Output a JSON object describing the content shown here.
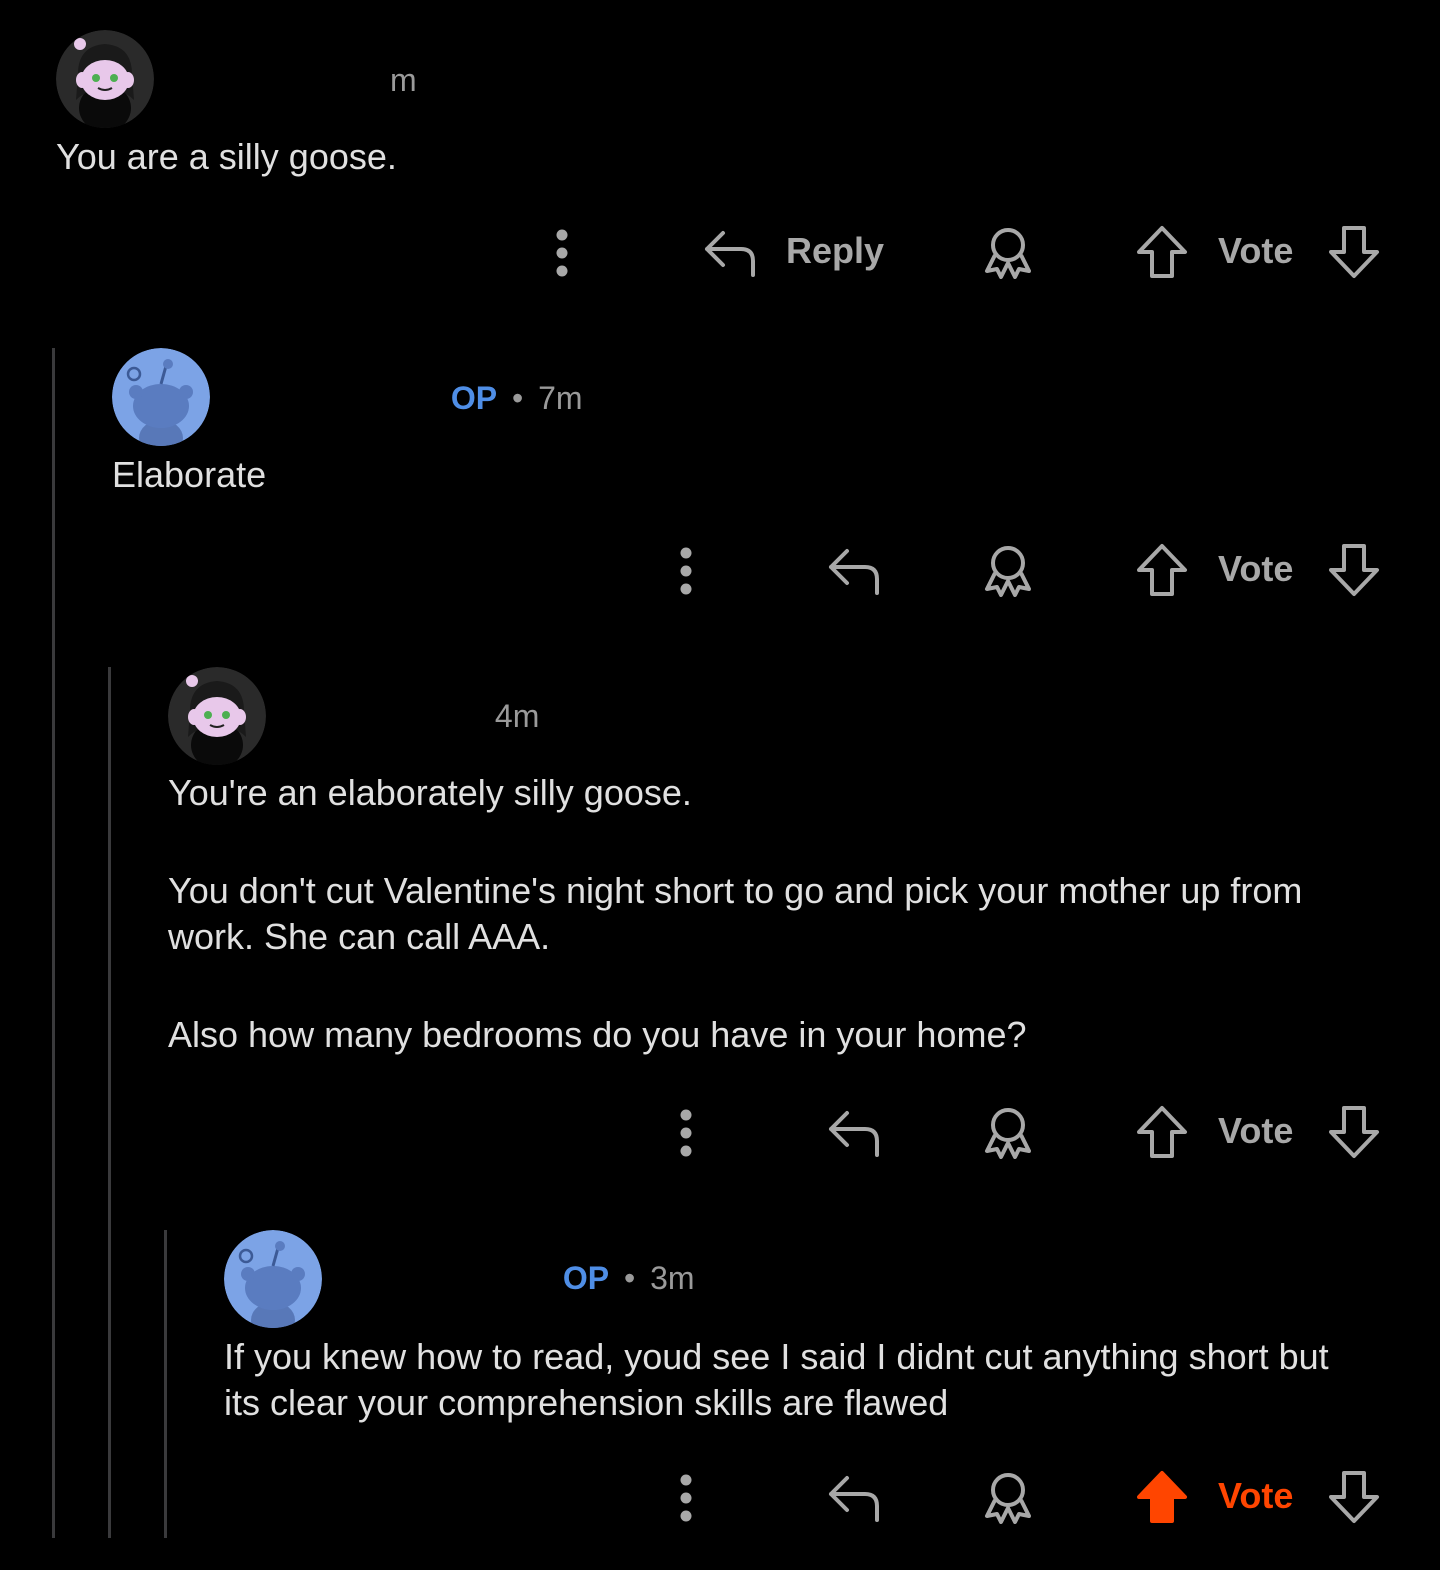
{
  "comments": [
    {
      "username": "",
      "meta_time": "m",
      "is_op": false,
      "op_label": "",
      "body": [
        "You are a silly goose."
      ],
      "reply_label": "Reply",
      "vote_label": "Vote",
      "voted": "none",
      "avatar": "custom-snoo-avatar"
    },
    {
      "username": "",
      "op_label": "OP",
      "sep": "•",
      "meta_time": "7m",
      "is_op": true,
      "body": [
        "Elaborate"
      ],
      "reply_label": "",
      "vote_label": "Vote",
      "voted": "none",
      "avatar": "default-snoo-avatar"
    },
    {
      "username": "",
      "meta_time": "4m",
      "is_op": false,
      "op_label": "",
      "body": [
        "You're an elaborately silly goose.",
        "You don't cut Valentine's night short to go and pick your mother up from work. She can call AAA.",
        "Also how many bedrooms do you have in your home?"
      ],
      "reply_label": "",
      "vote_label": "Vote",
      "voted": "none",
      "avatar": "custom-snoo-avatar"
    },
    {
      "username": "",
      "op_label": "OP",
      "sep": "•",
      "meta_time": "3m",
      "is_op": true,
      "body": [
        "If you knew how to read, youd see I said I didnt cut anything short but its clear your comprehension skills are flawed"
      ],
      "reply_label": "",
      "vote_label": "Vote",
      "voted": "up",
      "avatar": "default-snoo-avatar"
    }
  ],
  "colors": {
    "background": "#000000",
    "op_blue": "#4f8ee6",
    "upvote_orange": "#ff4500",
    "muted": "#a8a8a8",
    "thread_line": "#3a3a3c"
  }
}
